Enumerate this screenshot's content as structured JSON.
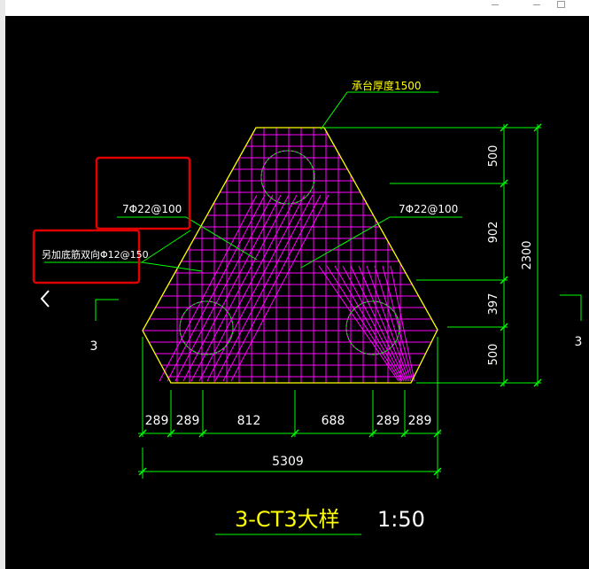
{
  "thickness_note": "承台厚度1500",
  "rebar_bottom_left": "7Φ22@100",
  "rebar_bottom_right": "7Φ22@100",
  "rebar_additional": "另加底筋双向Φ12@150",
  "dims_right": [
    "500",
    "902",
    "397",
    "500"
  ],
  "dim_total_height": "2300",
  "dims_bottom": [
    "289",
    "289",
    "812",
    "688",
    "289",
    "289"
  ],
  "dim_total_width": "5309",
  "section_label": "3",
  "section_label_right": "3",
  "drawing_title": "3-CT3大样",
  "scale": "1:50",
  "colors": {
    "background": "#000000",
    "outline": "#ffff00",
    "rebar": "#ff00ff",
    "dimension": "#00ff00",
    "text": "#ffff00",
    "highlight": "#e00000"
  },
  "icons": [
    "chevron-left-icon",
    "minimize-icon",
    "maximize-icon"
  ]
}
